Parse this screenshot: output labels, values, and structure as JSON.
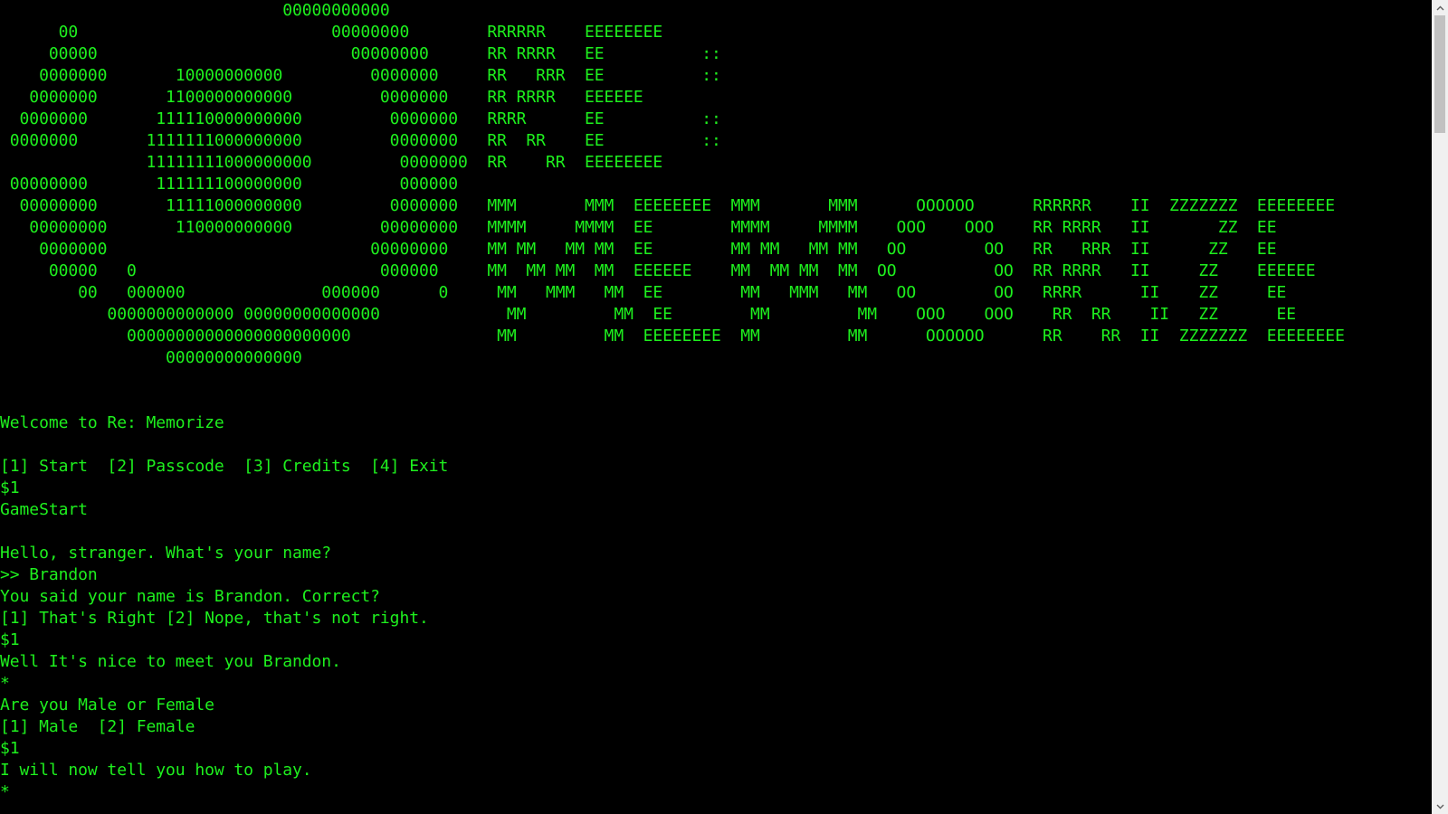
{
  "terminal": {
    "text_color": "#1EF01E",
    "background": "#000000",
    "lines": [
      "                             00000000000",
      "      00                          00000000        RRRRRR    EEEEEEEE",
      "     00000                          00000000      RR RRRR   EE          ::",
      "    0000000       10000000000         0000000     RR   RRR  EE          ::",
      "   0000000       1100000000000         0000000    RR RRRR   EEEEEE",
      "  0000000       111110000000000         0000000   RRRR      EE          ::",
      " 0000000       1111111000000000         0000000   RR  RR    EE          ::",
      "               11111111000000000         0000000  RR    RR  EEEEEEEE",
      " 00000000       111111100000000          000000",
      "  00000000       11111000000000         0000000   MMM       MMM  EEEEEEEE  MMM       MMM      OOOOOO      RRRRRR    II  ZZZZZZZ  EEEEEEEE",
      "   00000000       110000000000         00000000   MMMM     MMMM  EE        MMMM     MMMM    OOO    OOO    RR RRRR   II       ZZ  EE",
      "    0000000                           00000000    MM MM   MM MM  EE        MM MM   MM MM   OO        OO   RR   RRR  II      ZZ   EE",
      "     00000   0                         000000     MM  MM MM  MM  EEEEEE    MM  MM MM  MM  OO          OO  RR RRRR   II     ZZ    EEEEEE",
      "        00   000000              000000      0     MM   MMM   MM  EE        MM   MMM   MM   OO        OO   RRRR      II    ZZ     EE",
      "           0000000000000 00000000000000             MM         MM  EE        MM         MM    OOO    OOO    RR  RR    II   ZZ      EE",
      "             00000000000000000000000               MM         MM  EEEEEEEE  MM         MM      OOOOOO      RR    RR  II  ZZZZZZZ  EEEEEEEE",
      "                 00000000000000",
      "",
      "",
      "Welcome to Re: Memorize",
      "",
      "[1] Start  [2] Passcode  [3] Credits  [4] Exit",
      "$1",
      "GameStart",
      "",
      "Hello, stranger. What's your name?",
      ">> Brandon",
      "You said your name is Brandon. Correct?",
      "[1] That's Right [2] Nope, that's not right.",
      "$1",
      "Well It's nice to meet you Brandon.",
      "*",
      "Are you Male or Female",
      "[1] Male  [2] Female",
      "$1",
      "I will now tell you how to play.",
      "*"
    ]
  },
  "scrollbar": {
    "up_icon": "chevron-up-icon",
    "down_icon": "chevron-down-icon",
    "thumb_position_fraction": 0.0,
    "thumb_size_fraction": 0.15
  }
}
